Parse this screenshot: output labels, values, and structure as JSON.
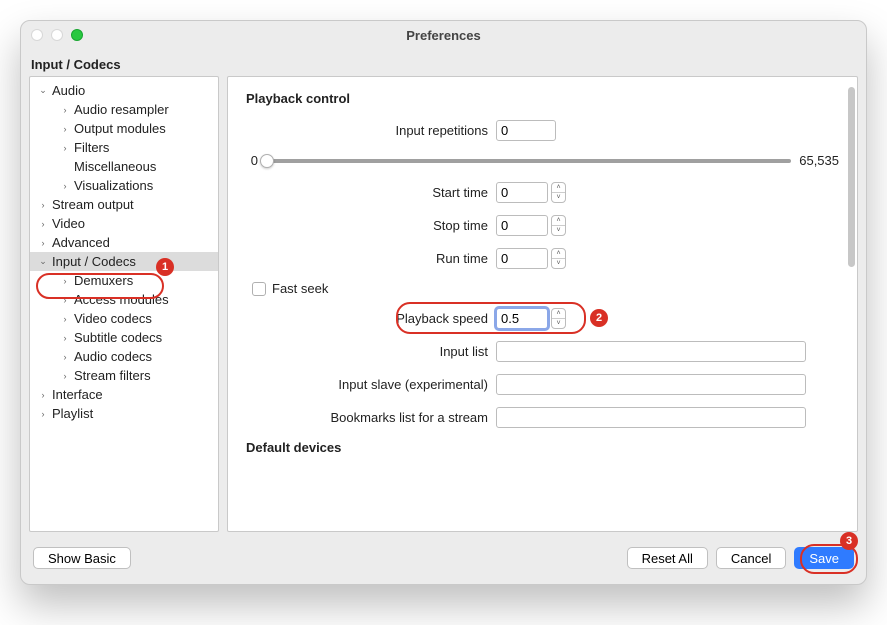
{
  "window": {
    "title": "Preferences"
  },
  "section": "Input / Codecs",
  "tree": {
    "audio": {
      "label": "Audio",
      "children": {
        "resampler": "Audio resampler",
        "output": "Output modules",
        "filters": "Filters",
        "misc": "Miscellaneous",
        "viz": "Visualizations"
      }
    },
    "stream_output": "Stream output",
    "video": "Video",
    "advanced": "Advanced",
    "input_codecs": {
      "label": "Input / Codecs",
      "children": {
        "demuxers": "Demuxers",
        "access": "Access modules",
        "vcodecs": "Video codecs",
        "scodecs": "Subtitle codecs",
        "acodecs": "Audio codecs",
        "sfilters": "Stream filters"
      }
    },
    "interface": "Interface",
    "playlist": "Playlist"
  },
  "panel": {
    "playback_control": "Playback control",
    "input_repetitions": {
      "label": "Input repetitions",
      "value": "0"
    },
    "slider": {
      "min": "0",
      "max": "65,535"
    },
    "start_time": {
      "label": "Start time",
      "value": "0"
    },
    "stop_time": {
      "label": "Stop time",
      "value": "0"
    },
    "run_time": {
      "label": "Run time",
      "value": "0"
    },
    "fast_seek": "Fast seek",
    "playback_speed": {
      "label": "Playback speed",
      "value": "0.5"
    },
    "input_list": {
      "label": "Input list",
      "value": ""
    },
    "input_slave": {
      "label": "Input slave (experimental)",
      "value": ""
    },
    "bookmarks": {
      "label": "Bookmarks list for a stream",
      "value": ""
    },
    "default_devices": "Default devices"
  },
  "footer": {
    "show_basic": "Show Basic",
    "reset_all": "Reset All",
    "cancel": "Cancel",
    "save": "Save"
  },
  "annotations": {
    "1": "1",
    "2": "2",
    "3": "3"
  }
}
